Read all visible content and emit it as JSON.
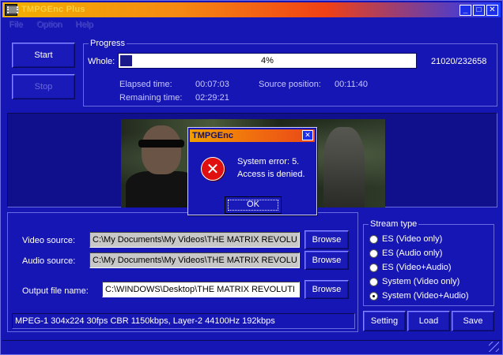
{
  "window": {
    "title": "TMPGEnc Plus",
    "controls": {
      "minimize": "_",
      "maximize": "□",
      "close": "✕"
    }
  },
  "menu": [
    "File",
    "Option",
    "Help"
  ],
  "actions": {
    "start": "Start",
    "stop": "Stop"
  },
  "progress": {
    "group_label": "Progress",
    "whole_label": "Whole:",
    "percent": 4,
    "percent_text": "4%",
    "frames": "21020/232658",
    "elapsed_label": "Elapsed time:",
    "elapsed_value": "00:07:03",
    "remaining_label": "Remaining time:",
    "remaining_value": "02:29:21",
    "source_label": "Source position:",
    "source_value": "00:11:40"
  },
  "dialog": {
    "title": "TMPGEnc",
    "close": "✕",
    "icon": "error-icon",
    "message_line1": "System error: 5.",
    "message_line2": "Access is denied.",
    "ok": "OK"
  },
  "sources": {
    "video_label": "Video source:",
    "video_value": "C:\\My Documents\\My Videos\\THE MATRIX REVOLU",
    "audio_label": "Audio source:",
    "audio_value": "C:\\My Documents\\My Videos\\THE MATRIX REVOLU",
    "output_label": "Output file name:",
    "output_value": "C:\\WINDOWS\\Desktop\\THE MATRIX REVOLUTI",
    "browse": "Browse"
  },
  "stream_type": {
    "label": "Stream type",
    "options": [
      {
        "label": "ES (Video only)",
        "checked": false
      },
      {
        "label": "ES (Audio only)",
        "checked": false
      },
      {
        "label": "ES (Video+Audio)",
        "checked": false
      },
      {
        "label": "System (Video only)",
        "checked": false
      },
      {
        "label": "System (Video+Audio)",
        "checked": true
      }
    ]
  },
  "format_info": "MPEG-1 304x224 30fps CBR 1150kbps,  Layer-2 44100Hz 192kbps",
  "bottom_buttons": {
    "setting": "Setting",
    "load": "Load",
    "save": "Save"
  },
  "colors": {
    "background": "#1616b4",
    "title_start": "#f2b100",
    "title_end": "#1e3cff",
    "error": "#e01010"
  }
}
